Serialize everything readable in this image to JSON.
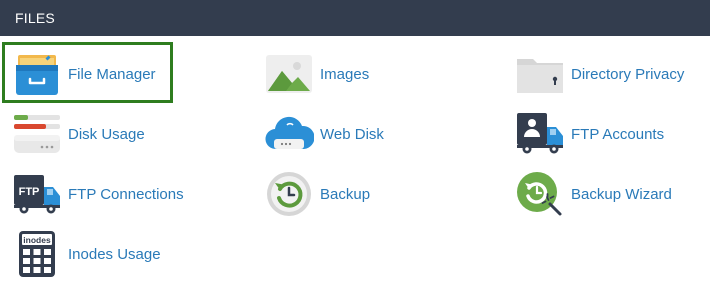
{
  "section": {
    "title": "FILES"
  },
  "items": [
    {
      "label": "File Manager",
      "icon": "file-manager-icon"
    },
    {
      "label": "Images",
      "icon": "images-icon"
    },
    {
      "label": "Directory Privacy",
      "icon": "directory-privacy-icon"
    },
    {
      "label": "Disk Usage",
      "icon": "disk-usage-icon"
    },
    {
      "label": "Web Disk",
      "icon": "web-disk-icon"
    },
    {
      "label": "FTP Accounts",
      "icon": "ftp-accounts-icon"
    },
    {
      "label": "FTP Connections",
      "icon": "ftp-connections-icon"
    },
    {
      "label": "Backup",
      "icon": "backup-icon"
    },
    {
      "label": "Backup Wizard",
      "icon": "backup-wizard-icon"
    },
    {
      "label": "Inodes Usage",
      "icon": "inodes-usage-icon"
    }
  ],
  "icon_text": {
    "ftp": "FTP",
    "inodes": "inodes"
  },
  "colors": {
    "header_bg": "#333d4e",
    "link": "#2a7ab8",
    "highlight": "#2e7d1f"
  }
}
